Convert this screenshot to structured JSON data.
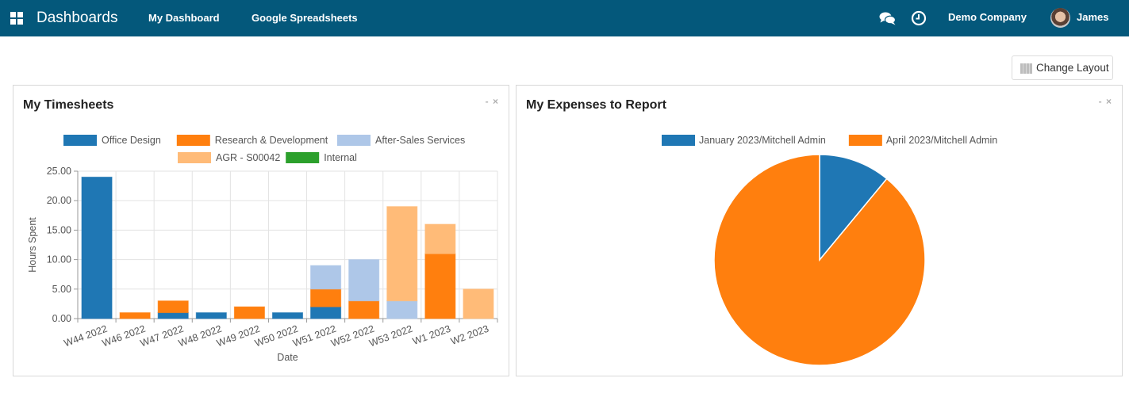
{
  "navbar": {
    "brand": "Dashboards",
    "links": [
      "My Dashboard",
      "Google Spreadsheets"
    ],
    "company": "Demo Company",
    "user": "James",
    "icons": [
      "apps-grid-icon",
      "chat-icon",
      "clock-icon",
      "user-avatar"
    ],
    "bg_color": "#04587b"
  },
  "toolbar": {
    "change_layout_label": "Change Layout"
  },
  "panels": [
    {
      "title": "My Timesheets",
      "minimize": "-",
      "close": "×"
    },
    {
      "title": "My Expenses to Report",
      "minimize": "-",
      "close": "×"
    }
  ],
  "chart_data": [
    {
      "type": "bar",
      "stacked": true,
      "title": "My Timesheets",
      "xlabel": "Date",
      "ylabel": "Hours Spent",
      "ylim": [
        0,
        25
      ],
      "yticks": [
        "0.00",
        "5.00",
        "10.00",
        "15.00",
        "20.00",
        "25.00"
      ],
      "grid": true,
      "legend_position": "top",
      "categories": [
        "W44 2022",
        "W46 2022",
        "W47 2022",
        "W48 2022",
        "W49 2022",
        "W50 2022",
        "W51 2022",
        "W52 2022",
        "W53 2022",
        "W1 2023",
        "W2 2023"
      ],
      "series": [
        {
          "name": "Office Design",
          "color": "#1f77b4",
          "values": [
            24,
            0,
            1,
            1,
            0,
            1,
            2,
            0,
            0,
            0,
            0
          ]
        },
        {
          "name": "Research & Development",
          "color": "#ff7f0e",
          "values": [
            0,
            1,
            2,
            0,
            2,
            0,
            3,
            3,
            0,
            11,
            0
          ]
        },
        {
          "name": "After-Sales Services",
          "color": "#aec7e8",
          "values": [
            0,
            0,
            0,
            0,
            0,
            0,
            4,
            7,
            3,
            0,
            0
          ]
        },
        {
          "name": "AGR - S00042",
          "color": "#ffbb78",
          "values": [
            0,
            0,
            0,
            0,
            0,
            0,
            0,
            0,
            16,
            5,
            5
          ]
        },
        {
          "name": "Internal",
          "color": "#2ca02c",
          "values": [
            0,
            0,
            0,
            0,
            0,
            0,
            0,
            0,
            0,
            0,
            0
          ]
        }
      ]
    },
    {
      "type": "pie",
      "title": "My Expenses to Report",
      "legend_position": "top",
      "slices": [
        {
          "label": "January 2023/Mitchell Admin",
          "color": "#1f77b4",
          "value": 11
        },
        {
          "label": "April 2023/Mitchell Admin",
          "color": "#ff7f0e",
          "value": 89
        }
      ]
    }
  ]
}
